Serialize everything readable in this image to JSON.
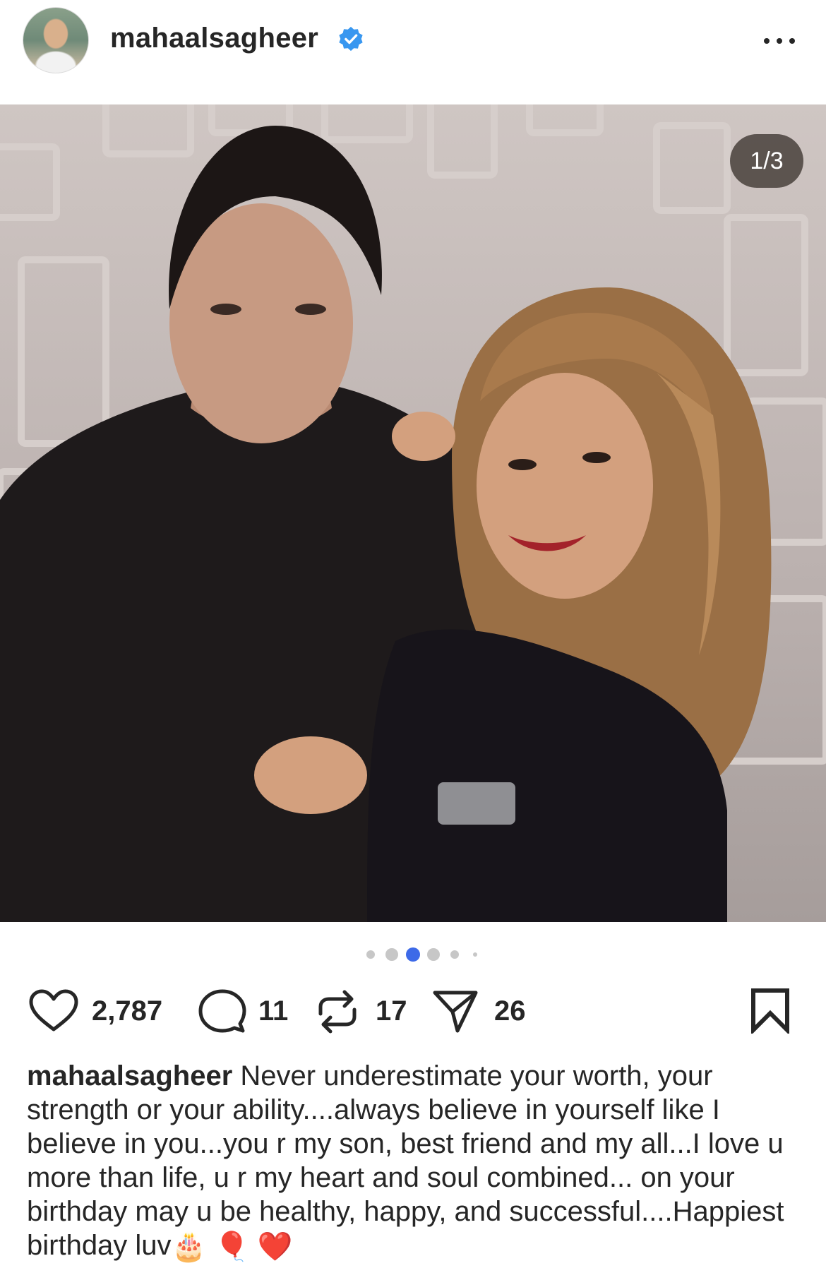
{
  "post": {
    "username": "mahaalsagheer",
    "verified": true,
    "more_icon": "more-horizontal-icon",
    "avatar_icon": "profile-avatar",
    "carousel": {
      "counter": "1/3",
      "current_slide": 3,
      "dot_count": 6
    },
    "stats": {
      "likes": "2,787",
      "comments": "11",
      "reposts": "17",
      "shares": "26"
    },
    "caption": {
      "username": "mahaalsagheer",
      "text": "Never underestimate your worth, your strength or your ability....always believe in yourself like I believe in you...you r my son, best friend and my all...I love u more than life, u r my heart and soul combined... on your birthday may u be healthy, happy, and successful....Happiest birthday luv",
      "emojis": [
        "🎂",
        "🎈",
        "❤️"
      ]
    }
  },
  "colors": {
    "verified_blue": "#3897f0",
    "active_dot": "#3d6ae8",
    "text": "#262626"
  },
  "icons": [
    "heart-icon",
    "comment-icon",
    "repost-icon",
    "share-icon",
    "bookmark-icon",
    "verified-badge-icon"
  ]
}
